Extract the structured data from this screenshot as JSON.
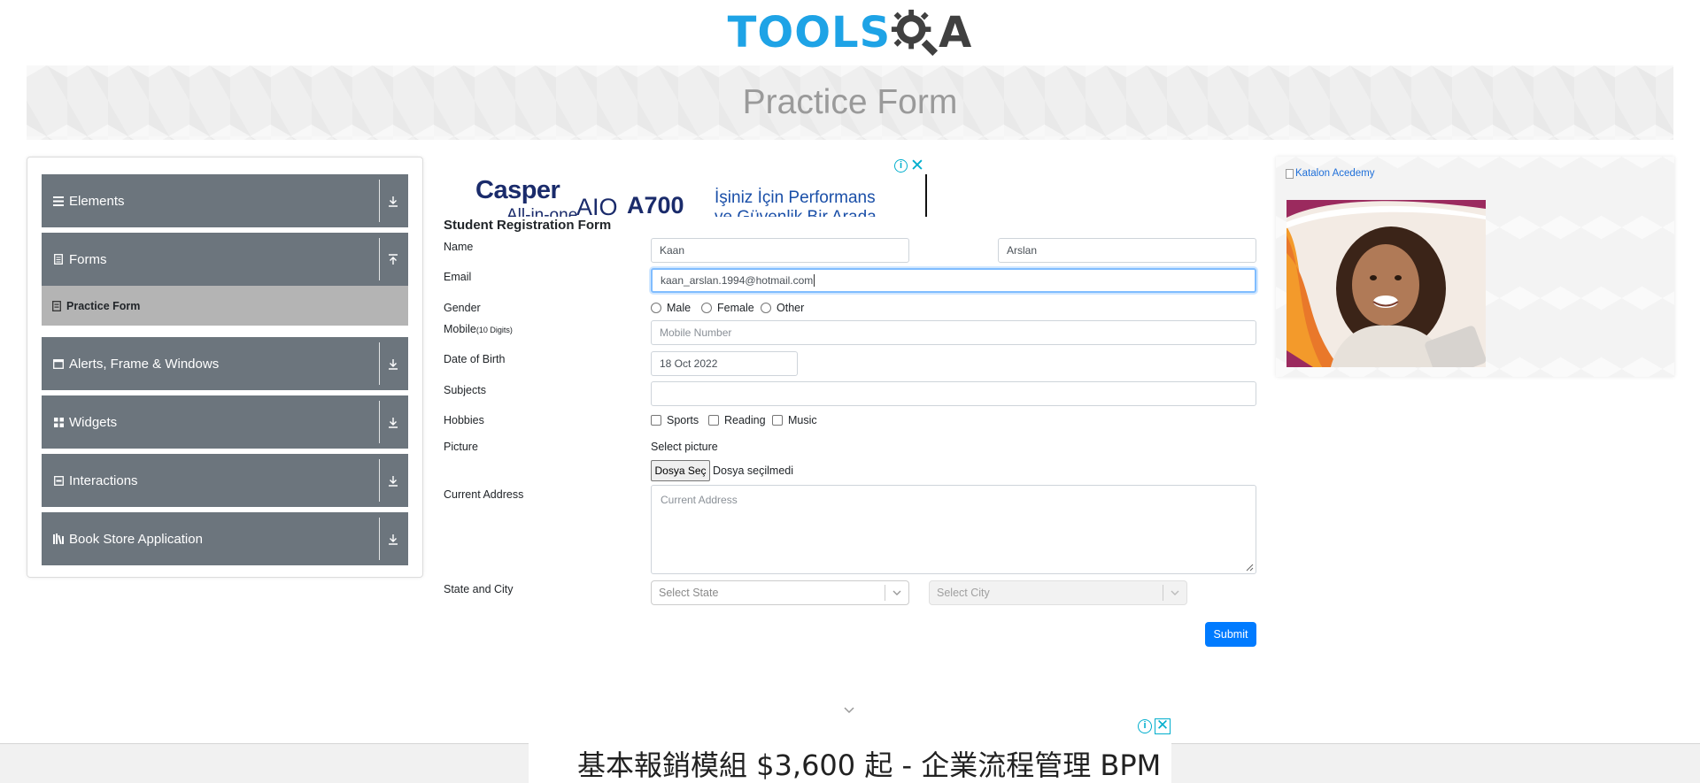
{
  "header": {
    "logo_tools": "TOOLS",
    "logo_qa": "A",
    "page_title": "Practice Form"
  },
  "sidebar": {
    "groups": [
      {
        "label": "Elements",
        "icon": "menu-icon",
        "arrow": "download-arrow-icon"
      },
      {
        "label": "Forms",
        "icon": "document-icon",
        "arrow": "upload-arrow-icon"
      },
      {
        "label": "Alerts, Frame & Windows",
        "icon": "window-icon",
        "arrow": "download-arrow-icon"
      },
      {
        "label": "Widgets",
        "icon": "grid-icon",
        "arrow": "download-arrow-icon"
      },
      {
        "label": "Interactions",
        "icon": "box-icon",
        "arrow": "download-arrow-icon"
      },
      {
        "label": "Book Store Application",
        "icon": "books-icon",
        "arrow": "download-arrow-icon"
      }
    ],
    "active_item": {
      "label": "Practice Form",
      "icon": "form-icon"
    }
  },
  "ad_top": {
    "brand": "Casper",
    "model_a": "AIO",
    "model_b": "A700",
    "tagline_1": "İşiniz İçin Performans",
    "tagline_2": "ve Güvenlik Bir Arada",
    "cut_text": "All-in-one",
    "info": "i",
    "close": "✕"
  },
  "form": {
    "title": "Student Registration Form",
    "name": {
      "label": "Name",
      "first_value": "Kaan",
      "last_value": "Arslan"
    },
    "email": {
      "label": "Email",
      "value": "kaan_arslan.1994@hotmail.com"
    },
    "gender": {
      "label": "Gender",
      "options": [
        "Male",
        "Female",
        "Other"
      ]
    },
    "mobile": {
      "label": "Mobile",
      "label_small": "(10 Digits)",
      "placeholder": "Mobile Number"
    },
    "dob": {
      "label": "Date of Birth",
      "value": "18 Oct 2022"
    },
    "subjects": {
      "label": "Subjects",
      "value": ""
    },
    "hobbies": {
      "label": "Hobbies",
      "options": [
        "Sports",
        "Reading",
        "Music"
      ]
    },
    "picture": {
      "label": "Picture",
      "select_text": "Select picture",
      "button": "Dosya Seç",
      "no_file": "Dosya seçilmedi"
    },
    "address": {
      "label": "Current Address",
      "placeholder": "Current Address"
    },
    "state_city": {
      "label": "State and City",
      "state_placeholder": "Select State",
      "city_placeholder": "Select City"
    },
    "submit": "Submit"
  },
  "right_ad": {
    "alt_text": "Katalon Acedemy"
  },
  "ad_bottom": {
    "text": "基本報銷模組 $3,600 起 - 企業流程管理 BPM",
    "info": "i",
    "close": "✕"
  },
  "colors": {
    "sidebar_group": "#6c757d",
    "sidebar_active": "#b4b4b4",
    "submit": "#007bff",
    "logo_blue": "#1ea3e6",
    "ad_accent": "#00aecd"
  }
}
